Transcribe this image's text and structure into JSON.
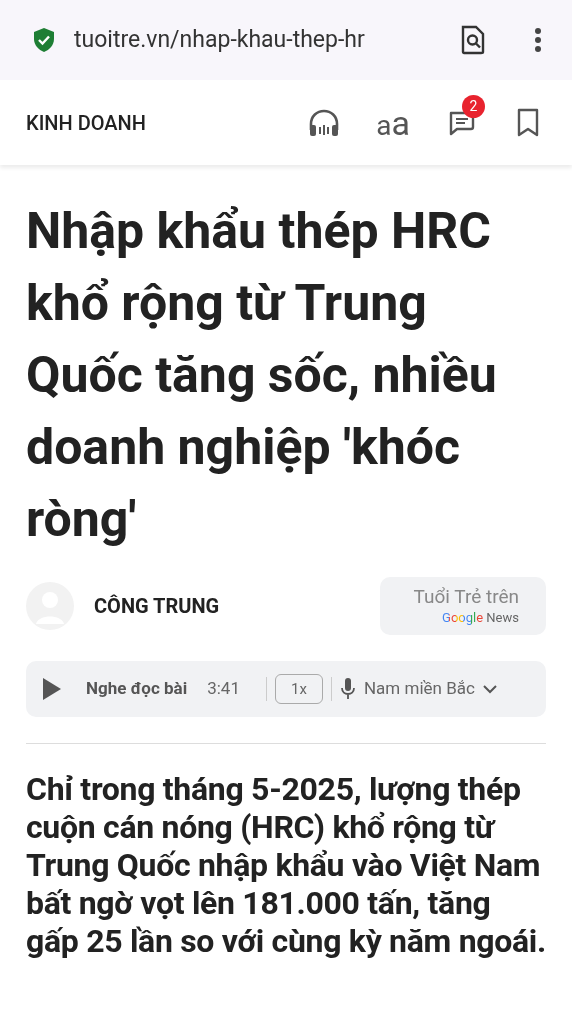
{
  "browser": {
    "url": "tuoitre.vn/nhap-khau-thep-hr"
  },
  "nav": {
    "section": "KINH DOANH",
    "font_toggle": "aa",
    "comment_count": "2"
  },
  "article": {
    "title": "Nhập khẩu thép HRC khổ rộng từ Trung Quốc tăng sốc, nhiều doanh nghiệp 'khóc ròng'",
    "author": "CÔNG TRUNG",
    "google_news": {
      "label": "Tuổi Trẻ trên",
      "brand": "Google",
      "product": "News"
    },
    "audio": {
      "label": "Nghe đọc bài",
      "duration": "3:41",
      "speed": "1x",
      "voice": "Nam miền Bắc"
    },
    "lead": "Chỉ trong tháng 5-2025, lượng thép cuộn cán nóng (HRC) khổ rộng từ Trung Quốc nhập khẩu vào Việt Nam bất ngờ vọt lên 181.000 tấn, tăng gấp 25 lần so với cùng kỳ năm ngoái."
  }
}
